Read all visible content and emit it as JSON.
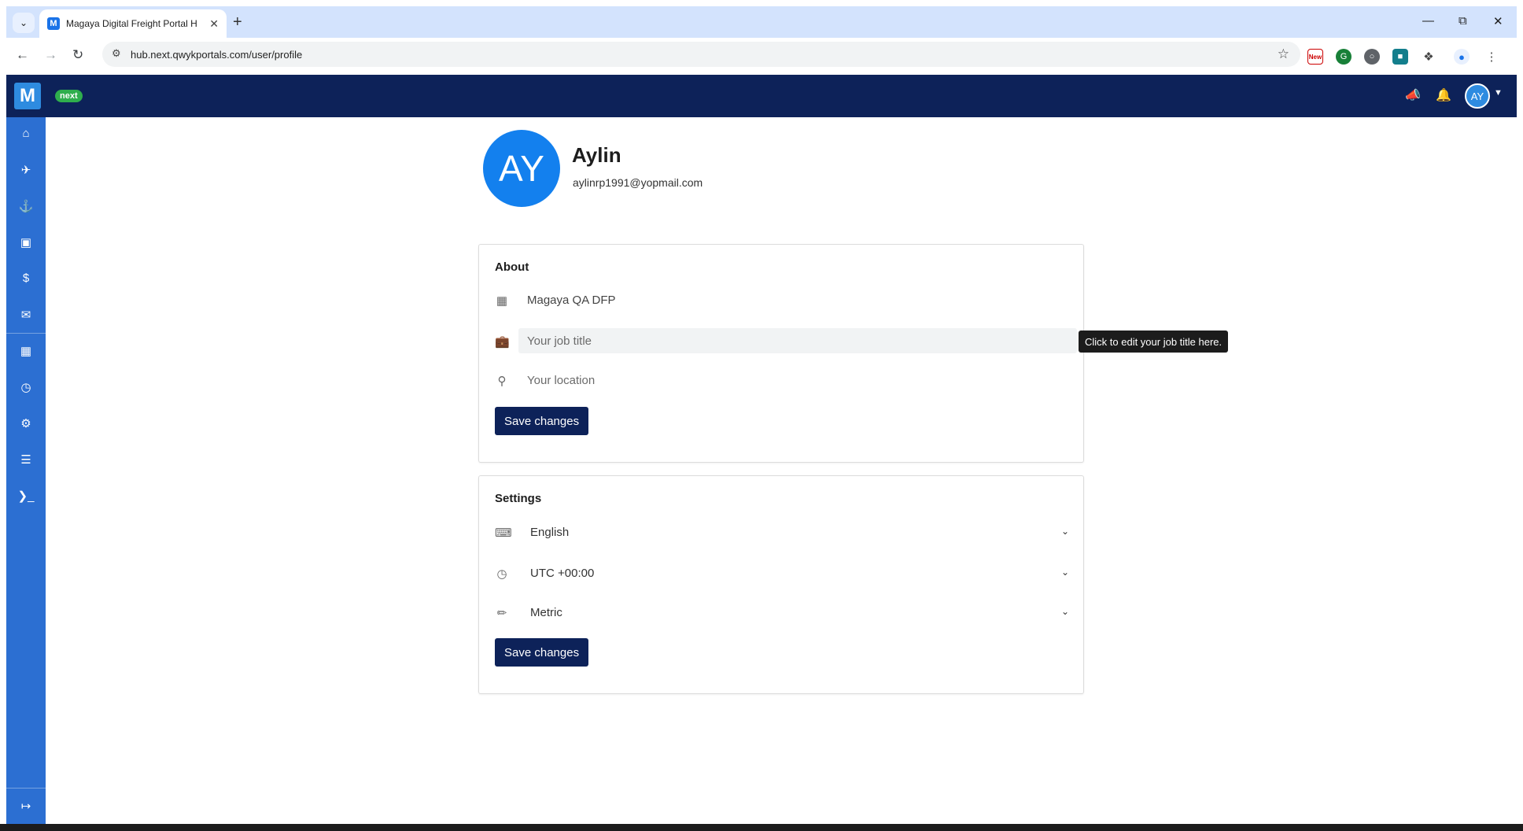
{
  "browser": {
    "tab_title": "Magaya Digital Freight Portal H",
    "tab_favicon": "M",
    "url": "hub.next.qwykportals.com/user/profile",
    "extension_new_label": "New"
  },
  "header": {
    "logo_letter": "M",
    "badge": "next",
    "avatar_initials": "AY"
  },
  "profile": {
    "initials": "AY",
    "name": "Aylin",
    "email": "aylinrp1991@yopmail.com"
  },
  "about": {
    "title": "About",
    "company": "Magaya QA DFP",
    "job_title_placeholder": "Your job title",
    "location_placeholder": "Your location",
    "save_label": "Save changes",
    "tooltip": "Click to edit your job title here."
  },
  "settings": {
    "title": "Settings",
    "language": "English",
    "timezone": "UTC +00:00",
    "units": "Metric",
    "save_label": "Save changes"
  },
  "sidebar": {
    "icons": [
      "home-icon",
      "shipments-icon",
      "cargo-icon",
      "inventory-icon",
      "billing-icon",
      "messages-icon",
      "warehouse-icon",
      "history-icon",
      "settings-icon",
      "library-icon",
      "terminal-icon",
      "logout-icon"
    ]
  },
  "colors": {
    "header": "#0d2259",
    "sidebar": "#2c6fd2",
    "avatar": "#1380ee",
    "button": "#0d2259",
    "badge": "#2fae4d"
  }
}
